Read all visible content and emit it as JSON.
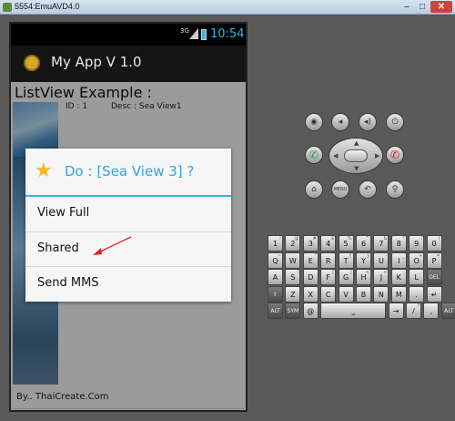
{
  "window": {
    "title": "5554:EmuAVD4.0",
    "min": "–",
    "max": "□",
    "close": "✕"
  },
  "status": {
    "network": "3G",
    "time": "10:54"
  },
  "app": {
    "title": "My App V 1.0"
  },
  "list": {
    "heading": "ListView Example :",
    "row": {
      "id": "ID : 1",
      "desc": "Desc : Sea View1"
    },
    "footer": "By.. ThaiCreate.Com"
  },
  "dialog": {
    "icon": "star-icon",
    "title": "Do : [Sea View 3] ?",
    "items": [
      "View Full",
      "Shared",
      "Send MMS"
    ]
  },
  "controls": {
    "top": [
      {
        "name": "camera-icon",
        "glyph": "◉"
      },
      {
        "name": "volume-down-icon",
        "glyph": "◂"
      },
      {
        "name": "volume-up-icon",
        "glyph": "◂)"
      },
      {
        "name": "power-icon",
        "glyph": "⏻"
      }
    ],
    "call": "✆",
    "endcall": "✆",
    "bottom": [
      {
        "name": "home-icon",
        "glyph": "⌂"
      },
      {
        "name": "menu-button",
        "glyph": "MENU"
      },
      {
        "name": "back-icon",
        "glyph": "↶"
      },
      {
        "name": "search-icon",
        "glyph": "⚲"
      }
    ]
  },
  "keyboard": {
    "row1": [
      [
        "1",
        "!"
      ],
      [
        "2",
        "@"
      ],
      [
        "3",
        "#"
      ],
      [
        "4",
        "$"
      ],
      [
        "5",
        "%"
      ],
      [
        "6",
        "^"
      ],
      [
        "7",
        "&"
      ],
      [
        "8",
        "*"
      ],
      [
        "9",
        "("
      ],
      [
        "0",
        ")"
      ]
    ],
    "row2": [
      [
        "Q",
        "~"
      ],
      [
        "W",
        ""
      ],
      [
        "E",
        "\""
      ],
      [
        "R",
        ""
      ],
      [
        "T",
        "{"
      ],
      [
        "Y",
        "}"
      ],
      [
        "U",
        "-"
      ],
      [
        "I",
        "_"
      ],
      [
        "O",
        "+"
      ],
      [
        "P",
        "="
      ]
    ],
    "row3": [
      [
        "A",
        ""
      ],
      [
        "S",
        "\\"
      ],
      [
        "D",
        ""
      ],
      [
        "F",
        "["
      ],
      [
        "G",
        "]"
      ],
      [
        "H",
        "<"
      ],
      [
        "J",
        ">"
      ],
      [
        "K",
        ";"
      ],
      [
        "L",
        ":"
      ],
      [
        "DEL",
        ""
      ]
    ],
    "row4": [
      [
        "⇧",
        ""
      ],
      [
        "Z",
        ""
      ],
      [
        "X",
        ""
      ],
      [
        "C",
        ""
      ],
      [
        "V",
        ""
      ],
      [
        "B",
        ""
      ],
      [
        "N",
        ""
      ],
      [
        "M",
        ""
      ],
      [
        ".",
        ""
      ],
      [
        "↵",
        ""
      ]
    ],
    "row5": [
      [
        "ALT",
        ""
      ],
      [
        "SYM",
        ""
      ],
      [
        "@",
        ""
      ],
      [
        "⎵",
        ""
      ],
      [
        "→",
        ""
      ],
      [
        "/",
        "?"
      ],
      [
        ",",
        ""
      ],
      [
        "ALT",
        ""
      ]
    ]
  }
}
